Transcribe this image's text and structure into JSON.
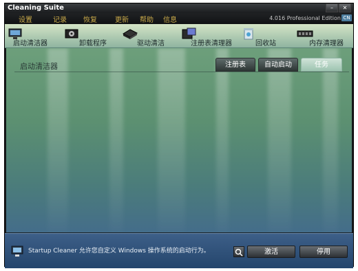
{
  "window": {
    "title": "Cleaning Suite",
    "minimize": "–",
    "close": "✕",
    "edition": "4.016 Professional Edition",
    "language_badge": "CN"
  },
  "menu": [
    {
      "label": "设置"
    },
    {
      "label": "记录"
    },
    {
      "label": "恢复"
    },
    {
      "label": "更新"
    },
    {
      "label": "帮助"
    },
    {
      "label": "信息"
    }
  ],
  "toolbar": [
    {
      "label": "启动清洁器",
      "icon": "startup-cleaner-icon"
    },
    {
      "label": "卸载程序",
      "icon": "uninstall-icon"
    },
    {
      "label": "驱动清洁",
      "icon": "drive-cleaner-icon"
    },
    {
      "label": "注册表清理器",
      "icon": "registry-cleaner-icon"
    },
    {
      "label": "回收站",
      "icon": "recycle-bin-icon"
    },
    {
      "label": "内存清理器",
      "icon": "memory-cleaner-icon"
    }
  ],
  "panel": {
    "title": "启动清洁器",
    "tabs": [
      {
        "label": "注册表",
        "active": false
      },
      {
        "label": "自动启动",
        "active": false
      },
      {
        "label": "任务",
        "active": true
      }
    ]
  },
  "status": {
    "text": "Startup Cleaner 允许您自定义 Windows 操作系统的启动行为。",
    "activate_label": "激活",
    "disable_label": "停用"
  },
  "colors": {
    "menu_text": "#c8a94a",
    "status_bar": "#2e5079"
  }
}
